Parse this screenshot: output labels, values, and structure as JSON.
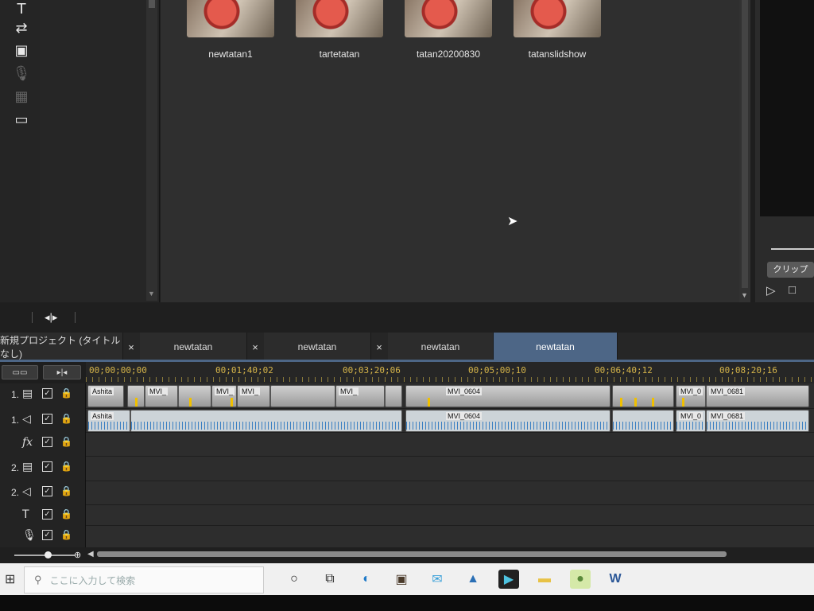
{
  "tools": [
    {
      "icon": "title-tool-icon",
      "glyph": "T"
    },
    {
      "icon": "transition-tool-icon",
      "glyph": "⇄"
    },
    {
      "icon": "effect-tool-icon",
      "glyph": "▣"
    },
    {
      "icon": "mic-tool-icon",
      "glyph": "🎙"
    },
    {
      "icon": "subtitle-grid-icon",
      "glyph": "▦"
    },
    {
      "icon": "subtitle-tool-icon",
      "glyph": "▭"
    }
  ],
  "media": [
    {
      "label": "newtatan1"
    },
    {
      "label": "tartetatan"
    },
    {
      "label": "tatan20200830"
    },
    {
      "label": "tatanslidshow"
    }
  ],
  "preview": {
    "clip_tab": "クリップ"
  },
  "tabs": [
    {
      "label": "新規プロジェクト (タイトルなし)",
      "close": "×"
    },
    {
      "label": "newtatan",
      "close": "×"
    },
    {
      "label": "newtatan",
      "close": "×"
    },
    {
      "label": "newtatan",
      "close": ""
    }
  ],
  "timeline": {
    "timecodes": [
      "00;00;00;00",
      "00;01;40;02",
      "00;03;20;06",
      "00;05;00;10",
      "00;06;40;12",
      "00;08;20;16"
    ],
    "clip_labels": {
      "v1": [
        "Ashita",
        "MVI_",
        "MVI_",
        "MVI_",
        "MVI_",
        "MVI_0604",
        "MVI_0",
        "MVI_0681"
      ],
      "a1": [
        "Ashita",
        "MVI_0604",
        "MVI_0",
        "MVI_0681"
      ]
    }
  },
  "tracks": [
    {
      "num": "1.",
      "icon": "video-track-icon",
      "glyph": "▤",
      "check": "✓",
      "lock": "🔒"
    },
    {
      "num": "1.",
      "icon": "audio-track-icon",
      "glyph": "◁",
      "check": "✓",
      "lock": "🔒"
    },
    {
      "num": "",
      "icon": "fx-track-icon",
      "glyph": "fx",
      "check": "✓",
      "lock": "🔒"
    },
    {
      "num": "2.",
      "icon": "video-track-icon",
      "glyph": "▤",
      "check": "✓",
      "lock": "🔒"
    },
    {
      "num": "2.",
      "icon": "audio-track-icon",
      "glyph": "◁",
      "check": "✓",
      "lock": "🔒"
    },
    {
      "num": "",
      "icon": "title-track-icon",
      "glyph": "T",
      "check": "✓",
      "lock": "🔒"
    },
    {
      "num": "",
      "icon": "voice-track-icon",
      "glyph": "🎙",
      "check": "✓",
      "lock": "🔒"
    }
  ],
  "taskbar": {
    "search_placeholder": "ここに入力して検索",
    "icons": [
      "cortana-icon",
      "task-view-icon",
      "edge-icon",
      "store-icon",
      "mail-icon",
      "photos-icon",
      "powerdirector-icon",
      "file-explorer-icon",
      "app-icon",
      "word-icon"
    ]
  }
}
